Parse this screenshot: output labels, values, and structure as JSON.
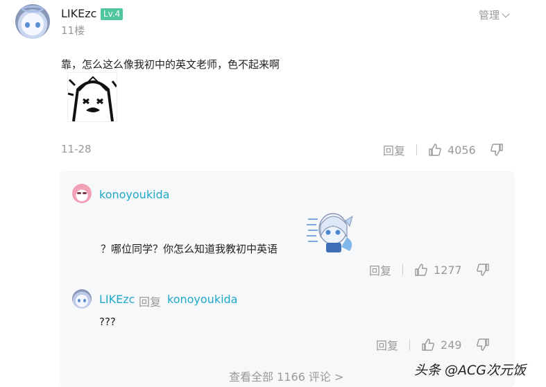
{
  "comment": {
    "username": "LIKEzc",
    "level": "Lv.4",
    "floor": "11楼",
    "manage_label": "管理",
    "content": "靠，怎么这么像我初中的英文老师，色不起来啊",
    "date": "11-28",
    "reply_label": "回复",
    "likes": "4056"
  },
  "replies": [
    {
      "username": "konoyoukida",
      "text": "？哪位同学？你怎么知道我教初中英语",
      "reply_label": "回复",
      "likes": "1277"
    },
    {
      "username": "LIKEzc",
      "reply_word": "回复",
      "reply_to": "konoyoukida",
      "text": "???",
      "reply_label": "回复",
      "likes": "249"
    }
  ],
  "view_all": "查看全部 1166 评论 >",
  "watermark": "头条 @ACG次元饭",
  "colors": {
    "level_badge": "#4fc6a0",
    "username_link": "#1fa8c9",
    "reply_box_bg": "#f7f8fa",
    "muted_text": "#999999"
  }
}
